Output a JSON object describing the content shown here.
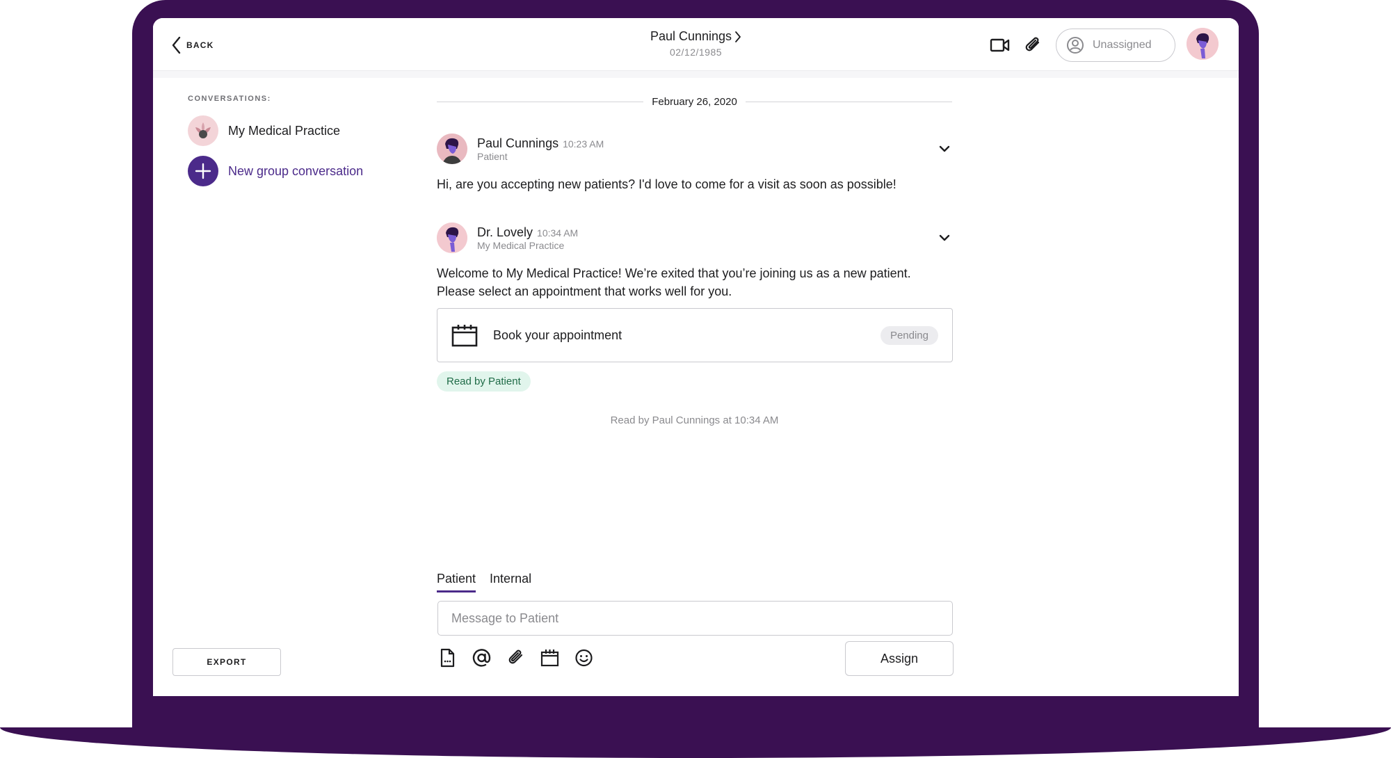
{
  "header": {
    "back_label": "BACK",
    "patient_name": "Paul Cunnings",
    "patient_dob": "02/12/1985",
    "assignee_label": "Unassigned"
  },
  "sidebar": {
    "heading": "CONVERSATIONS:",
    "items": [
      {
        "label": "My Medical Practice",
        "icon": "lotus-icon"
      },
      {
        "label": "New group conversation",
        "icon": "plus-icon",
        "color": "#4b2a8a"
      }
    ],
    "export_label": "EXPORT"
  },
  "thread": {
    "date": "February 26, 2020",
    "messages": [
      {
        "sender": "Paul Cunnings",
        "time": "10:23 AM",
        "role": "Patient",
        "body": "Hi, are you accepting new patients? I'd love to come for a visit as soon as possible!"
      },
      {
        "sender": "Dr. Lovely",
        "time": "10:34 AM",
        "role": "My Medical Practice",
        "body_line1": "Welcome to My Medical Practice! We’re exited that you’re joining us as a new patient.",
        "body_line2": "Please select an appointment that works well for you."
      }
    ],
    "appointment": {
      "label": "Book your appointment",
      "status": "Pending"
    },
    "read_badge": "Read by Patient",
    "read_status": "Read by Paul Cunnings at 10:34 AM"
  },
  "composer": {
    "tabs": [
      {
        "label": "Patient",
        "active": true
      },
      {
        "label": "Internal",
        "active": false
      }
    ],
    "placeholder": "Message to Patient",
    "assign_label": "Assign"
  },
  "colors": {
    "frame": "#3a1052",
    "accent": "#4b2a8a",
    "read_badge_bg": "#e1f5ec",
    "read_badge_text": "#1f6b47"
  }
}
